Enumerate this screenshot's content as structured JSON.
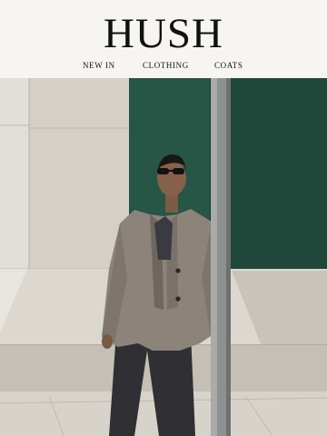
{
  "brand": {
    "name": "HUSH"
  },
  "nav": {
    "items": [
      {
        "label": "NEW IN"
      },
      {
        "label": "CLOTHING"
      },
      {
        "label": "COATS"
      }
    ]
  },
  "hero": {
    "image_icon": "fashion-photo",
    "colors": {
      "wall": "#d3cfc7",
      "glass": "#1f4a3c",
      "coat": "#8b8178",
      "trousers": "#2e2e33",
      "pole": "#8d8f8e",
      "pavement": "#cfc9bf"
    }
  }
}
